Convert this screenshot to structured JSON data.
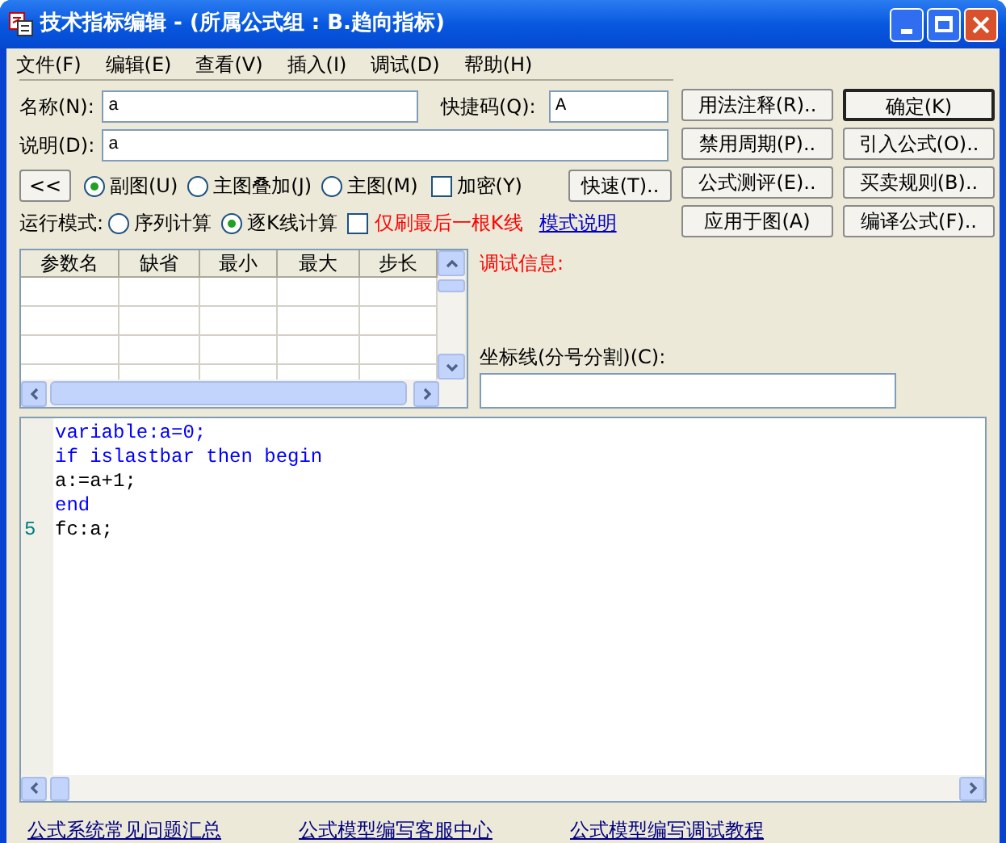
{
  "window": {
    "title": "技术指标编辑 - (所属公式组 : B.趋向指标)"
  },
  "menu": [
    "文件(F)",
    "编辑(E)",
    "查看(V)",
    "插入(I)",
    "调试(D)",
    "帮助(H)"
  ],
  "name_field": {
    "label": "名称(N):",
    "value": "a"
  },
  "shortcut_field": {
    "label": "快捷码(Q):",
    "value": "A"
  },
  "description_field": {
    "label": "说明(D):",
    "value": "a"
  },
  "collapse_button": "<<",
  "placement": [
    {
      "label": "副图(U)",
      "selected": true
    },
    {
      "label": "主图叠加(J)",
      "selected": false
    },
    {
      "label": "主图(M)",
      "selected": false
    }
  ],
  "encrypt": {
    "label": "加密(Y)",
    "checked": false
  },
  "quick_button": "快速(T)..",
  "run_mode": {
    "label": "运行模式:",
    "options": [
      {
        "label": "序列计算",
        "selected": false
      },
      {
        "label": "逐K线计算",
        "selected": true
      }
    ],
    "refresh_last": {
      "label": "仅刷最后一根K线",
      "checked": false
    },
    "help_link": "模式说明"
  },
  "buttons": [
    {
      "label": "用法注释(R)..",
      "default": false
    },
    {
      "label": "确定(K)",
      "default": true
    },
    {
      "label": "禁用周期(P)..",
      "default": false
    },
    {
      "label": "引入公式(O)..",
      "default": false
    },
    {
      "label": "公式测评(E)..",
      "default": false
    },
    {
      "label": "买卖规则(B)..",
      "default": false
    },
    {
      "label": "应用于图(A)",
      "default": false
    },
    {
      "label": "编译公式(F)..",
      "default": false
    }
  ],
  "params_table": {
    "columns": [
      "参数名",
      "缺省",
      "最小",
      "最大",
      "步长"
    ]
  },
  "debug_info": {
    "label": "调试信息:"
  },
  "axis_lines": {
    "label": "坐标线(分号分割)(C):"
  },
  "code_lines": [
    {
      "text": "variable:a=0;",
      "kind": "keyword"
    },
    {
      "text": "if islastbar then begin",
      "kind": "keyword"
    },
    {
      "text": "a:=a+1;",
      "kind": "plain"
    },
    {
      "text": "end",
      "kind": "keyword"
    },
    {
      "text": "fc:a;",
      "kind": "plain",
      "line_number": "5"
    }
  ],
  "links": [
    "公式系统常见问题汇总",
    "公式模型编写客服中心",
    "公式模型编写调试教程"
  ]
}
